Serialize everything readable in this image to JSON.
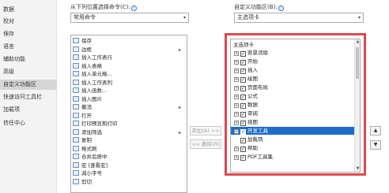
{
  "sidebar": {
    "items": [
      {
        "label": "数据",
        "active": false
      },
      {
        "label": "校对",
        "active": false
      },
      {
        "label": "保存",
        "active": false
      },
      {
        "label": "语言",
        "active": false
      },
      {
        "label": "辅助功能",
        "active": false
      },
      {
        "label": "高级",
        "active": false
      },
      {
        "label": "自定义功能区",
        "active": true
      },
      {
        "label": "快速访问工具栏",
        "active": false
      },
      {
        "label": "加载项",
        "active": false
      },
      {
        "label": "信任中心",
        "active": false
      }
    ]
  },
  "left_panel": {
    "label": "从下列位置选择命令(C):",
    "dropdown_value": "常用命令",
    "commands": [
      {
        "label": "保存",
        "has_submenu": false
      },
      {
        "label": "边框",
        "has_submenu": true
      },
      {
        "label": "插入工作表行",
        "has_submenu": false
      },
      {
        "label": "插入表格",
        "has_submenu": false
      },
      {
        "label": "插入单元格...",
        "has_submenu": false
      },
      {
        "label": "插入工作表列",
        "has_submenu": false
      },
      {
        "label": "插入函数...",
        "has_submenu": false
      },
      {
        "label": "插入图片",
        "has_submenu": false
      },
      {
        "label": "撤消",
        "has_submenu": true
      },
      {
        "label": "打开",
        "has_submenu": false
      },
      {
        "label": "打印预览和打印",
        "has_submenu": false
      },
      {
        "label": "添加筛选",
        "has_submenu": true
      },
      {
        "label": "复制",
        "has_submenu": false
      },
      {
        "label": "格式刷",
        "has_submenu": false
      },
      {
        "label": "合并后居中",
        "has_submenu": false
      },
      {
        "label": "宏 [查看宏]",
        "has_submenu": false
      },
      {
        "label": "减小字号",
        "has_submenu": false
      },
      {
        "label": "剪切",
        "has_submenu": false
      }
    ]
  },
  "middle": {
    "add_label": "添加(A) >>",
    "remove_label": "<< 删除(R)"
  },
  "right_panel": {
    "label": "自定义功能区(B):",
    "dropdown_value": "主选项卡",
    "tree_header": "主选项卡",
    "tabs": [
      {
        "label": "背景消除",
        "checked": true,
        "selected": false,
        "expander": "+"
      },
      {
        "label": "开始",
        "checked": true,
        "selected": false,
        "expander": "+"
      },
      {
        "label": "插入",
        "checked": true,
        "selected": false,
        "expander": "+"
      },
      {
        "label": "绘图",
        "checked": true,
        "selected": false,
        "expander": "+"
      },
      {
        "label": "页面布局",
        "checked": true,
        "selected": false,
        "expander": "+"
      },
      {
        "label": "公式",
        "checked": true,
        "selected": false,
        "expander": "+"
      },
      {
        "label": "数据",
        "checked": true,
        "selected": false,
        "expander": "+"
      },
      {
        "label": "审阅",
        "checked": true,
        "selected": false,
        "expander": "+"
      },
      {
        "label": "视图",
        "checked": true,
        "selected": false,
        "expander": "+"
      },
      {
        "label": "开发工具",
        "checked": true,
        "selected": true,
        "expander": "+"
      },
      {
        "label": "加载项",
        "checked": true,
        "selected": false,
        "expander": ""
      },
      {
        "label": "帮助",
        "checked": true,
        "selected": false,
        "expander": "+"
      },
      {
        "label": "PDF工具集",
        "checked": true,
        "selected": false,
        "expander": "+"
      }
    ]
  },
  "move_buttons": {
    "up": "▲",
    "down": "▼"
  },
  "colors": {
    "highlight_border": "#e0484e",
    "selection": "#1e6ec8",
    "accent": "#2b73c4"
  }
}
